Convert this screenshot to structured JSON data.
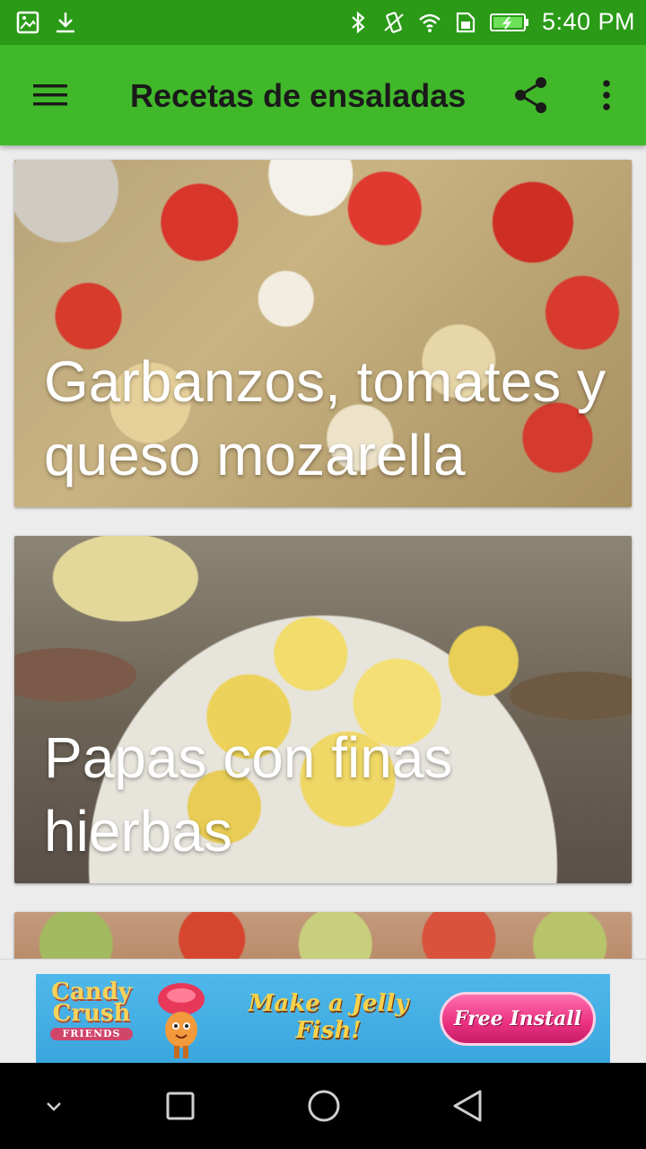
{
  "status_bar": {
    "time": "5:40 PM",
    "left_icons": [
      "gallery-icon",
      "download-icon"
    ],
    "right_icons": [
      "bluetooth-icon",
      "vibrate-icon",
      "wifi-icon",
      "sim-icon",
      "battery-icon"
    ]
  },
  "app_bar": {
    "title": "Recetas de ensaladas",
    "menu_icon": "hamburger-menu-icon",
    "share_icon": "share-icon",
    "more_icon": "more-vert-icon",
    "background": "#41b82a"
  },
  "recipes": [
    {
      "title": "Garbanzos, tomates y queso mozarella"
    },
    {
      "title": "Papas con finas hierbas"
    },
    {
      "title": ""
    }
  ],
  "ad": {
    "brand": "Candy Crush",
    "brand_sub": "FRIENDS",
    "tagline": "Make a Jelly Fish!",
    "cta": "Free Install"
  },
  "nav_bar": {
    "buttons": [
      "collapse-icon",
      "recents-icon",
      "home-icon",
      "back-icon"
    ]
  }
}
